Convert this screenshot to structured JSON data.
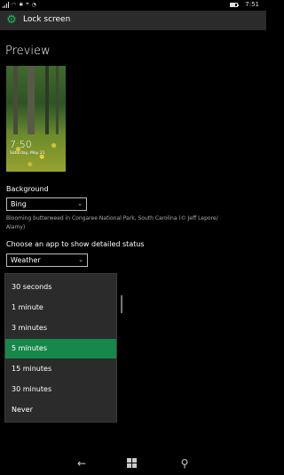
{
  "status_bar": {
    "time": "7:51"
  },
  "header": {
    "title": "Lock screen"
  },
  "preview": {
    "heading": "Preview",
    "time": "7:50",
    "date": "Saturday, May 21"
  },
  "background": {
    "label": "Background",
    "value": "Bing",
    "caption": "Blooming butterweed in Congaree National Park, South Carolina (© Jeff Lepore/ Alamy)"
  },
  "detailed_status": {
    "label": "Choose an app to show detailed status",
    "value": "Weather"
  },
  "timeout_options": {
    "items": [
      "30 seconds",
      "1 minute",
      "3 minutes",
      "5 minutes",
      "15 minutes",
      "30 minutes",
      "Never"
    ],
    "selected": "5 minutes"
  },
  "colors": {
    "accent": "#17884a",
    "header_bg": "#2b2b2b",
    "dropdown_bg": "#2b2b2b",
    "icon_green": "#1bbf5c"
  }
}
